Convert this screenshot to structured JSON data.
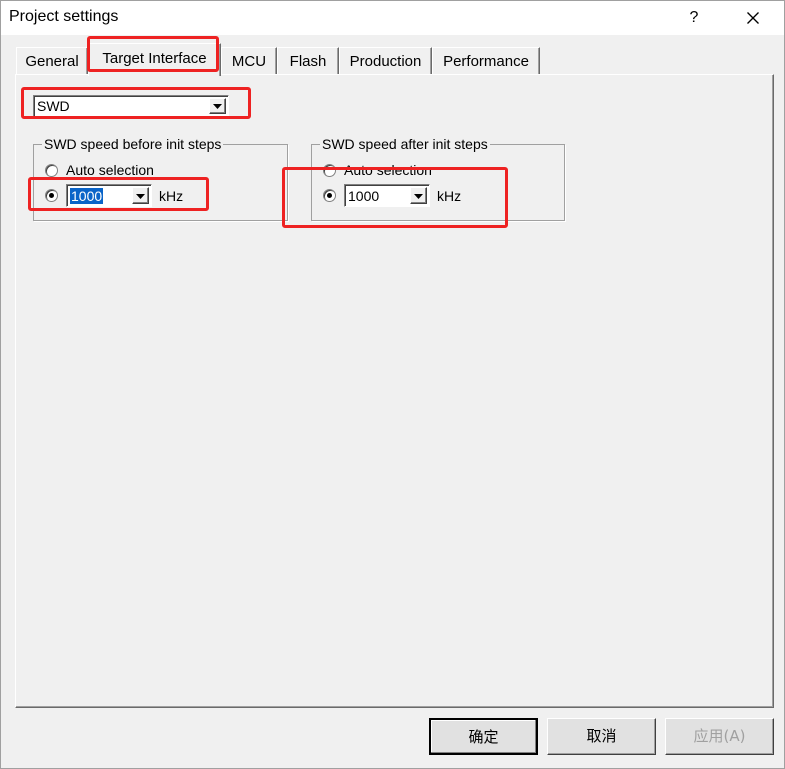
{
  "window": {
    "title": "Project settings",
    "help_label": "?",
    "close_icon": "close-icon"
  },
  "tabs": [
    {
      "label": "General",
      "active": false
    },
    {
      "label": "Target Interface",
      "active": true
    },
    {
      "label": "MCU",
      "active": false
    },
    {
      "label": "Flash",
      "active": false
    },
    {
      "label": "Production",
      "active": false
    },
    {
      "label": "Performance",
      "active": false
    }
  ],
  "interface": {
    "selected": "SWD"
  },
  "before_init": {
    "title": "SWD speed before init steps",
    "auto_label": "Auto selection",
    "auto_checked": false,
    "manual_checked": true,
    "speed_value": "1000",
    "unit": "kHz"
  },
  "after_init": {
    "title": "SWD speed after init steps",
    "auto_label": "Auto selection",
    "auto_checked": false,
    "manual_checked": true,
    "speed_value": "1000",
    "unit": "kHz"
  },
  "buttons": {
    "ok": "确定",
    "cancel": "取消",
    "apply": "应用(A)"
  },
  "colors": {
    "annotation": "#ee2222",
    "selection": "#0a64c8"
  }
}
